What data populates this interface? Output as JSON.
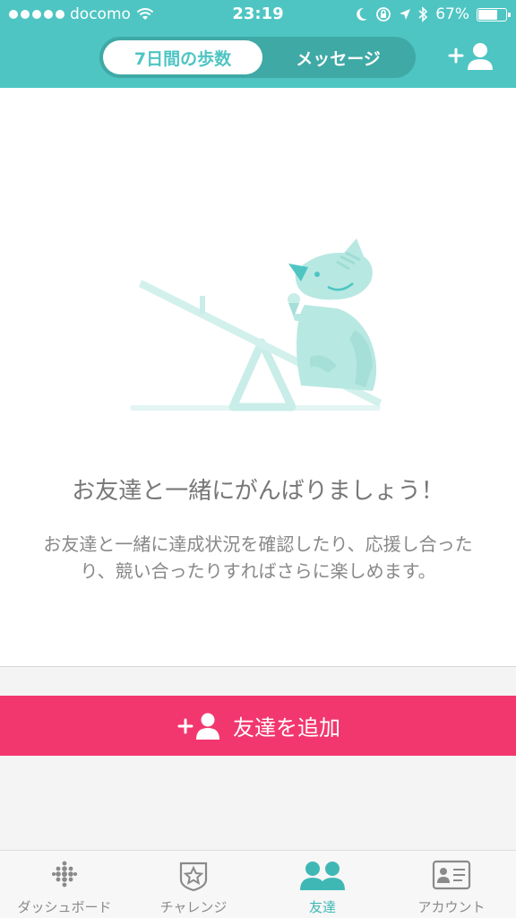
{
  "status_bar": {
    "carrier": "docomo",
    "time": "23:19",
    "battery": "67%"
  },
  "header": {
    "tabs": [
      {
        "label": "7日間の歩数",
        "active": true
      },
      {
        "label": "メッセージ",
        "active": false
      }
    ],
    "add_friend_icon": "add-person-icon"
  },
  "main": {
    "illustration": "fox-seesaw-icon",
    "headline": "お友達と一緒にがんばりましょう！",
    "description": "お友達と一緒に達成状況を確認したり、応援し合ったり、競い合ったりすればさらに楽しめます。",
    "cta_label": "友達を追加"
  },
  "tab_bar": {
    "items": [
      {
        "label": "ダッシュボード",
        "icon": "dashboard-dots-icon",
        "active": false
      },
      {
        "label": "チャレンジ",
        "icon": "star-badge-icon",
        "active": false
      },
      {
        "label": "友達",
        "icon": "friends-icon",
        "active": true
      },
      {
        "label": "アカウント",
        "icon": "id-card-icon",
        "active": false
      }
    ]
  },
  "colors": {
    "header": "#4ec5c3",
    "segment_bg": "#3fa9a6",
    "cta": "#f2376f",
    "active_tab": "#3fb8b5",
    "illustration": "#b8e8e2"
  }
}
